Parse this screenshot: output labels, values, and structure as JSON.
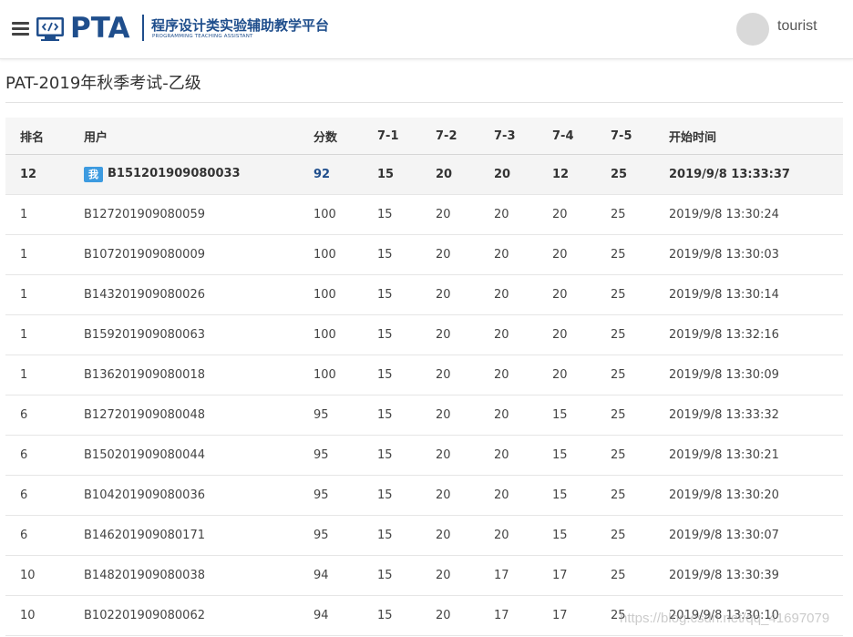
{
  "header": {
    "logo_text": "PTA",
    "logo_cn": "程序设计类实验辅助教学平台",
    "logo_en": "PROGRAMMING TEACHING ASSISTANT",
    "username": "tourist"
  },
  "page": {
    "title": "PAT-2019年秋季考试-乙级"
  },
  "table": {
    "columns": [
      "排名",
      "用户",
      "分数",
      "7-1",
      "7-2",
      "7-3",
      "7-4",
      "7-5",
      "开始时间"
    ],
    "me_badge": "我",
    "my_row": {
      "rank": "12",
      "user": "B151201909080033",
      "score": "92",
      "p1": "15",
      "p2": "20",
      "p3": "20",
      "p4": "12",
      "p5": "25",
      "start": "2019/9/8 13:33:37"
    },
    "rows": [
      {
        "rank": "1",
        "user": "B127201909080059",
        "score": "100",
        "p1": "15",
        "p2": "20",
        "p3": "20",
        "p4": "20",
        "p5": "25",
        "start": "2019/9/8 13:30:24"
      },
      {
        "rank": "1",
        "user": "B107201909080009",
        "score": "100",
        "p1": "15",
        "p2": "20",
        "p3": "20",
        "p4": "20",
        "p5": "25",
        "start": "2019/9/8 13:30:03"
      },
      {
        "rank": "1",
        "user": "B143201909080026",
        "score": "100",
        "p1": "15",
        "p2": "20",
        "p3": "20",
        "p4": "20",
        "p5": "25",
        "start": "2019/9/8 13:30:14"
      },
      {
        "rank": "1",
        "user": "B159201909080063",
        "score": "100",
        "p1": "15",
        "p2": "20",
        "p3": "20",
        "p4": "20",
        "p5": "25",
        "start": "2019/9/8 13:32:16"
      },
      {
        "rank": "1",
        "user": "B136201909080018",
        "score": "100",
        "p1": "15",
        "p2": "20",
        "p3": "20",
        "p4": "20",
        "p5": "25",
        "start": "2019/9/8 13:30:09"
      },
      {
        "rank": "6",
        "user": "B127201909080048",
        "score": "95",
        "p1": "15",
        "p2": "20",
        "p3": "20",
        "p4": "15",
        "p5": "25",
        "start": "2019/9/8 13:33:32"
      },
      {
        "rank": "6",
        "user": "B150201909080044",
        "score": "95",
        "p1": "15",
        "p2": "20",
        "p3": "20",
        "p4": "15",
        "p5": "25",
        "start": "2019/9/8 13:30:21"
      },
      {
        "rank": "6",
        "user": "B104201909080036",
        "score": "95",
        "p1": "15",
        "p2": "20",
        "p3": "20",
        "p4": "15",
        "p5": "25",
        "start": "2019/9/8 13:30:20"
      },
      {
        "rank": "6",
        "user": "B146201909080171",
        "score": "95",
        "p1": "15",
        "p2": "20",
        "p3": "20",
        "p4": "15",
        "p5": "25",
        "start": "2019/9/8 13:30:07"
      },
      {
        "rank": "10",
        "user": "B148201909080038",
        "score": "94",
        "p1": "15",
        "p2": "20",
        "p3": "17",
        "p4": "17",
        "p5": "25",
        "start": "2019/9/8 13:30:39"
      },
      {
        "rank": "10",
        "user": "B102201909080062",
        "score": "94",
        "p1": "15",
        "p2": "20",
        "p3": "17",
        "p4": "17",
        "p5": "25",
        "start": "2019/9/8 13:30:10"
      }
    ]
  },
  "watermark": "https://blog.csdn.net/qq_41697079",
  "colors": {
    "brand": "#1f4e8c",
    "badge": "#3d9be0"
  }
}
